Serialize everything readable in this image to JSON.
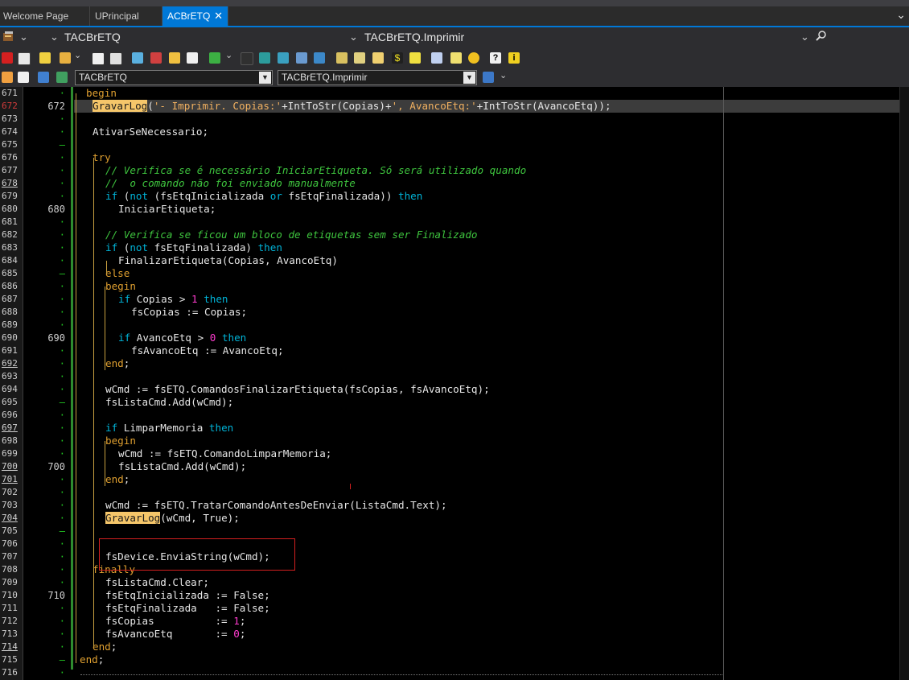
{
  "tabs": [
    {
      "label": "Welcome Page"
    },
    {
      "label": "UPrincipal"
    },
    {
      "label": "ACBrETQ",
      "active": true
    }
  ],
  "nav": {
    "class_name": "TACBrETQ",
    "method_name": "TACBrETQ.Imprimir"
  },
  "toolbar2": {
    "class_combo": "TACBrETQ",
    "method_combo": "TACBrETQ.Imprimir"
  },
  "colors": {
    "accent": "#0078d7",
    "background": "#000000",
    "keyword": "#e0a030",
    "comment": "#3ec43e",
    "number": "#ff3ccf",
    "highlight": "#3c3c3c"
  },
  "code_lines": [
    {
      "n": "671",
      "g": "·",
      "t": "begin"
    },
    {
      "n": "672",
      "g": "672",
      "t": "GravarLog('- Imprimir. Copias:'+IntToStr(Copias)+', AvancoEtq:'+IntToStr(AvancoEtq));"
    },
    {
      "n": "673",
      "g": "·",
      "t": ""
    },
    {
      "n": "674",
      "g": "·",
      "t": "AtivarSeNecessario;"
    },
    {
      "n": "675",
      "g": "–",
      "t": ""
    },
    {
      "n": "676",
      "g": "·",
      "t": "try"
    },
    {
      "n": "677",
      "g": "·",
      "t": "// Verifica se é necessário IniciarEtiqueta. Só será utilizado quando"
    },
    {
      "n": "678",
      "g": "·",
      "t": "//  o comando não foi enviado manualmente"
    },
    {
      "n": "679",
      "g": "·",
      "t": "if (not (fsEtqInicializada or fsEtqFinalizada)) then"
    },
    {
      "n": "680",
      "g": "680",
      "t": "IniciarEtiqueta;"
    },
    {
      "n": "681",
      "g": "·",
      "t": ""
    },
    {
      "n": "682",
      "g": "·",
      "t": "// Verifica se ficou um bloco de etiquetas sem ser Finalizado"
    },
    {
      "n": "683",
      "g": "·",
      "t": "if (not fsEtqFinalizada) then"
    },
    {
      "n": "684",
      "g": "·",
      "t": "FinalizarEtiqueta(Copias, AvancoEtq)"
    },
    {
      "n": "685",
      "g": "–",
      "t": "else"
    },
    {
      "n": "686",
      "g": "·",
      "t": "begin"
    },
    {
      "n": "687",
      "g": "·",
      "t": "if Copias > 1 then"
    },
    {
      "n": "688",
      "g": "·",
      "t": "fsCopias := Copias;"
    },
    {
      "n": "689",
      "g": "·",
      "t": ""
    },
    {
      "n": "690",
      "g": "690",
      "t": "if AvancoEtq > 0 then"
    },
    {
      "n": "691",
      "g": "·",
      "t": "fsAvancoEtq := AvancoEtq;"
    },
    {
      "n": "692",
      "g": "·",
      "t": "end;"
    },
    {
      "n": "693",
      "g": "·",
      "t": ""
    },
    {
      "n": "694",
      "g": "·",
      "t": "wCmd := fsETQ.ComandosFinalizarEtiqueta(fsCopias, fsAvancoEtq);"
    },
    {
      "n": "695",
      "g": "–",
      "t": "fsListaCmd.Add(wCmd);"
    },
    {
      "n": "696",
      "g": "·",
      "t": ""
    },
    {
      "n": "697",
      "g": "·",
      "t": "if LimparMemoria then"
    },
    {
      "n": "698",
      "g": "·",
      "t": "begin"
    },
    {
      "n": "699",
      "g": "·",
      "t": "wCmd := fsETQ.ComandoLimparMemoria;"
    },
    {
      "n": "700",
      "g": "700",
      "t": "fsListaCmd.Add(wCmd);"
    },
    {
      "n": "701",
      "g": "·",
      "t": "end;"
    },
    {
      "n": "702",
      "g": "·",
      "t": ""
    },
    {
      "n": "703",
      "g": "·",
      "t": "wCmd := fsETQ.TratarComandoAntesDeEnviar(ListaCmd.Text);"
    },
    {
      "n": "704",
      "g": "·",
      "t": "GravarLog(wCmd, True);"
    },
    {
      "n": "705",
      "g": "–",
      "t": ""
    },
    {
      "n": "706",
      "g": "·",
      "t": ""
    },
    {
      "n": "707",
      "g": "·",
      "t": "fsDevice.EnviaString(wCmd);"
    },
    {
      "n": "708",
      "g": "·",
      "t": "finally"
    },
    {
      "n": "709",
      "g": "·",
      "t": "fsListaCmd.Clear;"
    },
    {
      "n": "710",
      "g": "710",
      "t": "fsEtqInicializada := False;"
    },
    {
      "n": "711",
      "g": "·",
      "t": "fsEtqFinalizada   := False;"
    },
    {
      "n": "712",
      "g": "·",
      "t": "fsCopias          := 1;"
    },
    {
      "n": "713",
      "g": "·",
      "t": "fsAvancoEtq       := 0;"
    },
    {
      "n": "714",
      "g": "·",
      "t": "end;"
    },
    {
      "n": "715",
      "g": "–",
      "t": "end;"
    },
    {
      "n": "716",
      "g": "·",
      "t": ""
    }
  ]
}
